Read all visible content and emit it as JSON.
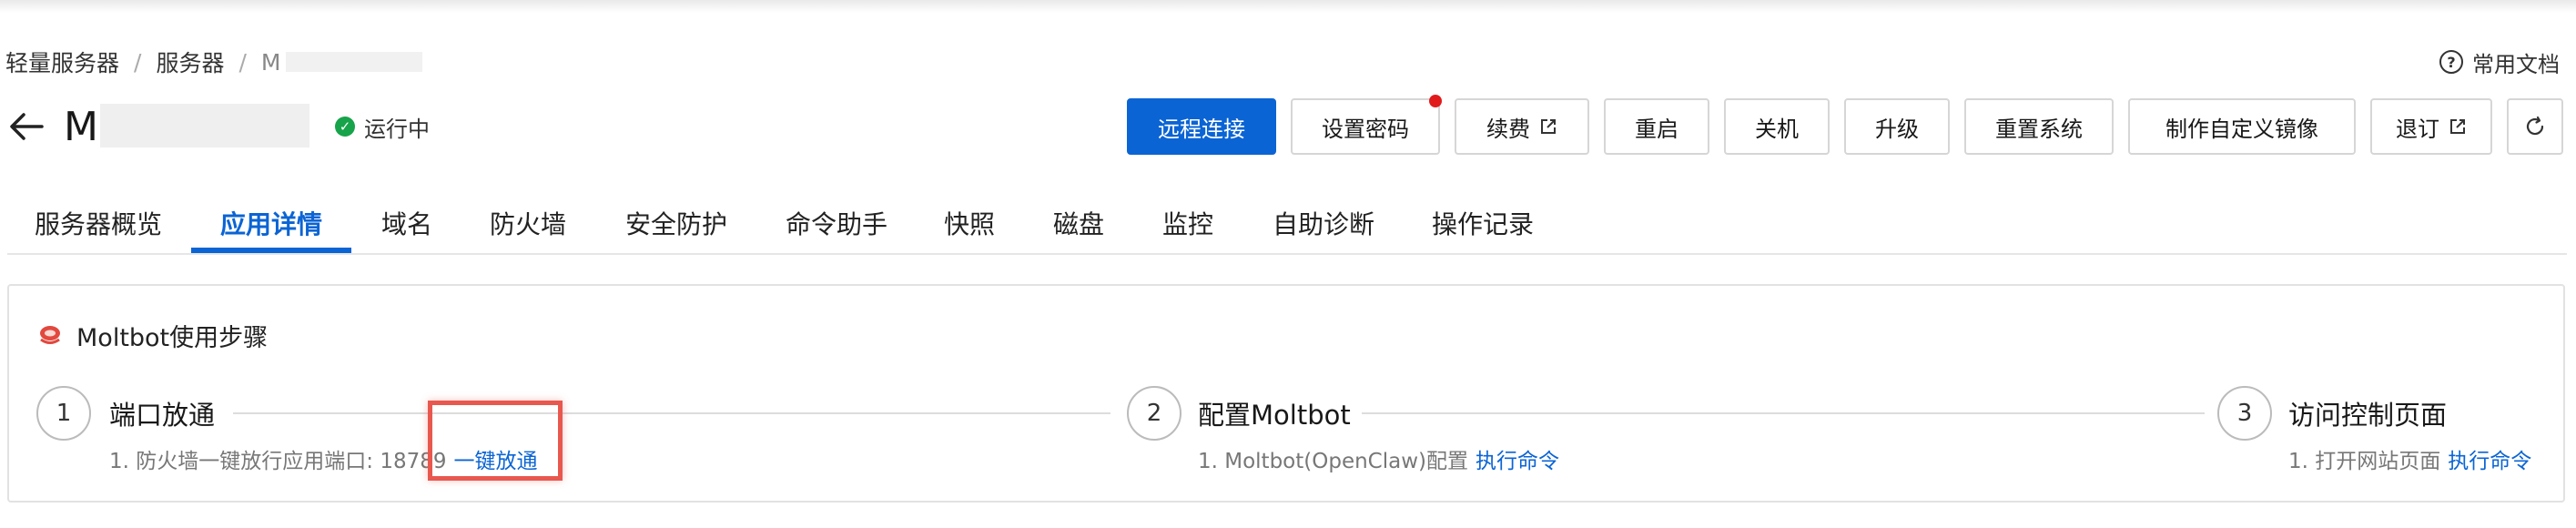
{
  "breadcrumb": {
    "items": [
      "轻量服务器",
      "服务器",
      "M"
    ]
  },
  "help": {
    "label": "常用文档"
  },
  "title": {
    "text": "M",
    "status": "运行中"
  },
  "actions": {
    "remote": "远程连接",
    "password": "设置密码",
    "renew": "续费",
    "restart": "重启",
    "shutdown": "关机",
    "upgrade": "升级",
    "reinstall": "重置系统",
    "image": "制作自定义镜像",
    "unsubscribe": "退订"
  },
  "tabs": [
    "服务器概览",
    "应用详情",
    "域名",
    "防火墙",
    "安全防护",
    "命令助手",
    "快照",
    "磁盘",
    "监控",
    "自助诊断",
    "操作记录"
  ],
  "card": {
    "title": "Moltbot使用步骤",
    "steps": [
      {
        "num": "1",
        "title": "端口放通",
        "desc": "1. 防火墙一键放行应用端口: 18789",
        "link": "一键放通"
      },
      {
        "num": "2",
        "title": "配置Moltbot",
        "desc": "1. Moltbot(OpenClaw)配置",
        "link": "执行命令"
      },
      {
        "num": "3",
        "title": "访问控制页面",
        "desc": "1. 打开网站页面",
        "link": "执行命令"
      }
    ]
  },
  "colors": {
    "primary": "#0b64d4",
    "status_ok": "#17a34a",
    "badge": "#e11b1b",
    "highlight": "#e8584f"
  }
}
